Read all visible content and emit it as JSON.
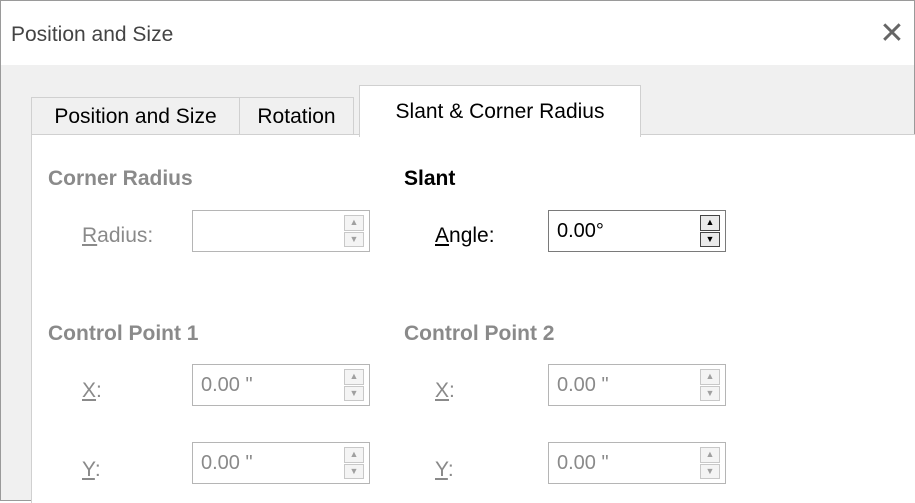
{
  "window": {
    "title": "Position and Size",
    "close_icon": "close-icon"
  },
  "tabs": [
    {
      "label": "Position and Size",
      "active": false
    },
    {
      "label": "Rotation",
      "active": false
    },
    {
      "label": "Slant & Corner Radius",
      "active": true
    }
  ],
  "corner_radius": {
    "heading": "Corner Radius",
    "radius_label_u": "R",
    "radius_label_rest": "adius:",
    "radius_value": "",
    "enabled": false
  },
  "slant": {
    "heading": "Slant",
    "angle_label_u": "A",
    "angle_label_rest": "ngle:",
    "angle_value": "0.00°",
    "enabled": true
  },
  "control_point_1": {
    "heading": "Control Point 1",
    "x_label_u": "X",
    "x_label_rest": ":",
    "x_value": "0.00 \"",
    "y_label_u": "Y",
    "y_label_rest": ":",
    "y_value": "0.00 \"",
    "enabled": false
  },
  "control_point_2": {
    "heading": "Control Point 2",
    "x_label_u": "X",
    "x_label_rest": ":",
    "x_value": "0.00 \"",
    "y_label_u": "Y",
    "y_label_rest": ":",
    "y_value": "0.00 \"",
    "enabled": false
  },
  "spin_icons": {
    "up": "▲",
    "down": "▼"
  }
}
